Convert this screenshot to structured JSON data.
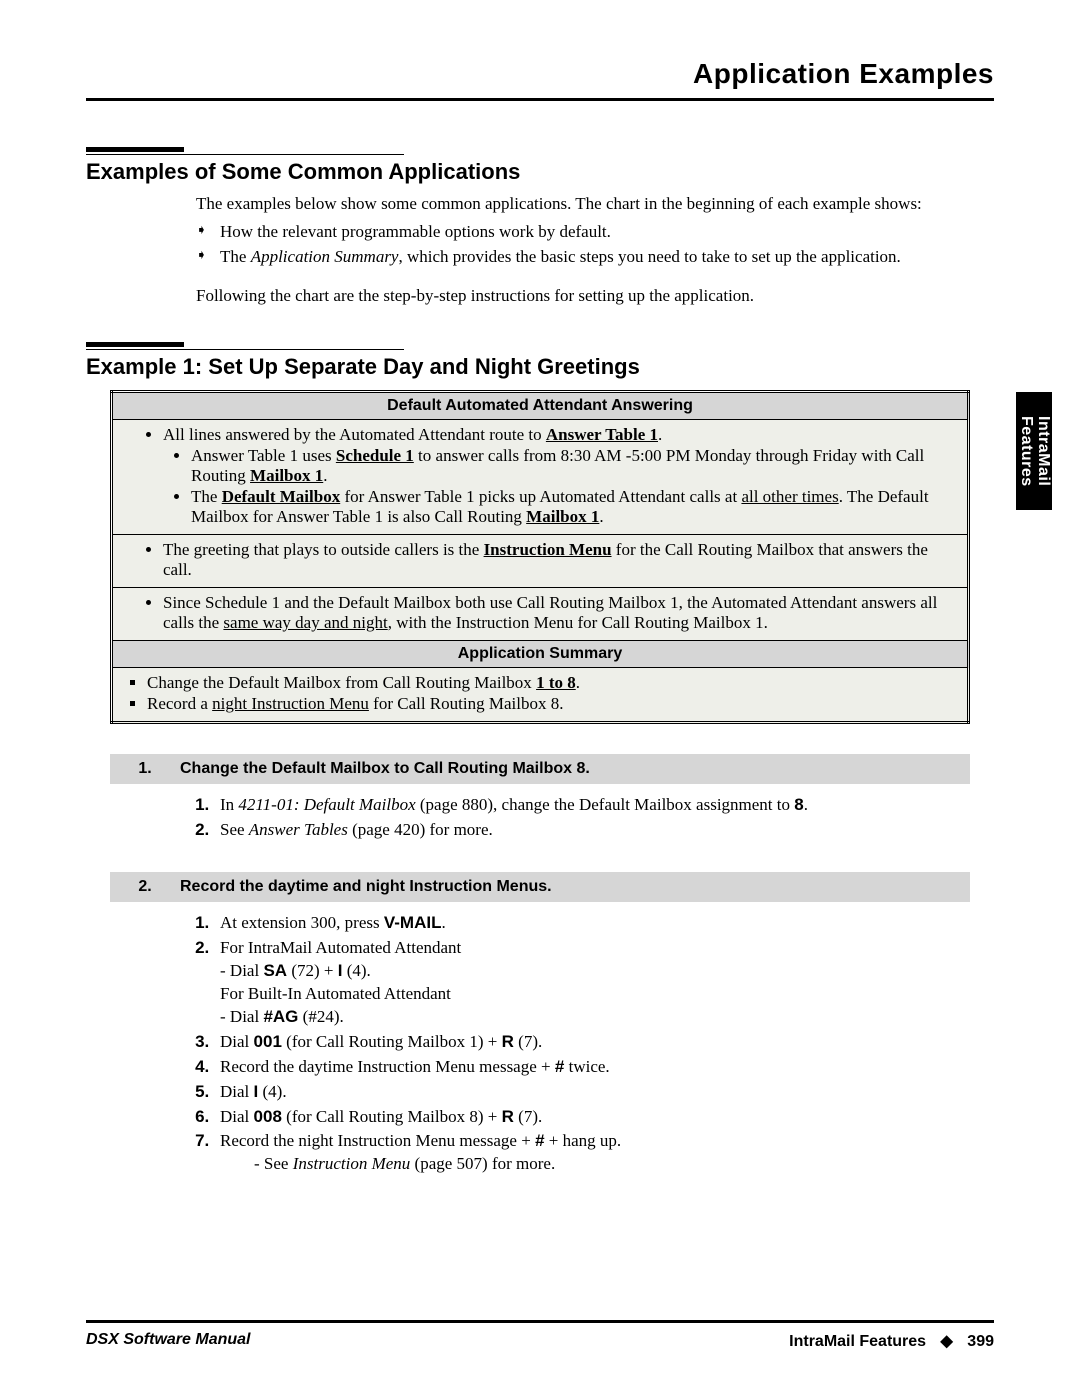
{
  "header": {
    "title": "Application Examples"
  },
  "section1": {
    "title": "Examples of Some Common Applications",
    "intro": "The examples below show some common applications. The chart in the beginning of each example shows:",
    "bullets": {
      "b1": "How the relevant programmable options work by default.",
      "b2_pre": "The ",
      "b2_em": "Application Summary",
      "b2_post": ", which provides the basic steps you need to take to set up the application."
    },
    "outro": "Following the chart are the step-by-step instructions for setting up the application."
  },
  "section2": {
    "title": "Example 1: Set Up Separate Day and Night Greetings"
  },
  "table1": {
    "header": "Default Automated Attendant Answering",
    "r1_a": "All lines answered by the Automated Attendant route to ",
    "r1_b": "Answer Table 1",
    "r1_c": ".",
    "r1_1a": "Answer Table 1 uses ",
    "r1_1b": "Schedule 1",
    "r1_1c": " to answer calls from 8:30 AM -5:00 PM Monday through Friday with Call Routing ",
    "r1_1d": "Mailbox 1",
    "r1_1e": ".",
    "r1_2a": "The ",
    "r1_2b": "Default Mailbox",
    "r1_2c": " for Answer Table 1 picks up Automated Attendant calls at ",
    "r1_2d": "all other times",
    "r1_2e": ". The Default Mailbox for Answer Table 1 is also Call Routing ",
    "r1_2f": "Mailbox 1",
    "r1_2g": ".",
    "r2_a": "The greeting that plays to outside callers is the ",
    "r2_b": "Instruction Menu",
    "r2_c": " for the Call Routing Mailbox that answers the call.",
    "r3_a": "Since Schedule 1 and the Default Mailbox both use Call Routing Mailbox 1, the Automated Attendant answers all calls the ",
    "r3_b": "same way day and night",
    "r3_c": ", with the Instruction Menu for Call Routing Mailbox 1.",
    "header2": "Application Summary",
    "s1_a": "Change the Default Mailbox from Call Routing Mailbox ",
    "s1_b": "1 to 8",
    "s1_c": ".",
    "s2_a": "Record a ",
    "s2_b": "night Instruction Menu",
    "s2_c": " for Call Routing Mailbox 8."
  },
  "step1": {
    "num": "1.",
    "title": "Change the Default Mailbox to Call Routing Mailbox 8.",
    "i1_a": "In ",
    "i1_b": "4211-01: Default Mailbox ",
    "i1_c": "(page 880), change the Default Mailbox assignment to ",
    "i1_d": "8",
    "i1_e": ".",
    "i2_a": "See ",
    "i2_b": "Answer Tables ",
    "i2_c": "(page 420) for more."
  },
  "step2": {
    "num": "2.",
    "title": "Record the daytime and night Instruction Menus.",
    "i1_a": "At extension 300, press ",
    "i1_b": "V-MAIL",
    "i1_c": ".",
    "i2_l1": "For IntraMail Automated Attendant",
    "i2_l2_a": "- Dial ",
    "i2_l2_b": "SA",
    "i2_l2_c": " (72) + ",
    "i2_l2_d": "I",
    "i2_l2_e": " (4).",
    "i2_l3": "For Built-In Automated Attendant",
    "i2_l4_a": "- Dial ",
    "i2_l4_b": "#AG",
    "i2_l4_c": " (#24).",
    "i3_a": "Dial ",
    "i3_b": "001",
    "i3_c": " (for Call Routing Mailbox 1) + ",
    "i3_d": "R",
    "i3_e": " (7).",
    "i4_a": "Record the daytime Instruction Menu message + ",
    "i4_b": "#",
    "i4_c": " twice.",
    "i5_a": "Dial ",
    "i5_b": "I",
    "i5_c": " (4).",
    "i6_a": "Dial ",
    "i6_b": "008",
    "i6_c": " (for Call Routing Mailbox 8) + ",
    "i6_d": "R",
    "i6_e": " (7).",
    "i7_a": "Record the night Instruction Menu message + ",
    "i7_b": "#",
    "i7_c": " + hang up.",
    "i7_sub_a": "-   See ",
    "i7_sub_b": "Instruction Menu ",
    "i7_sub_c": "(page 507) for more."
  },
  "footer": {
    "left": "DSX Software Manual",
    "right_label": "IntraMail Features",
    "diamond": "◆",
    "page": "399"
  },
  "side_tab": {
    "line1": "IntraMail",
    "line2": "Features"
  }
}
